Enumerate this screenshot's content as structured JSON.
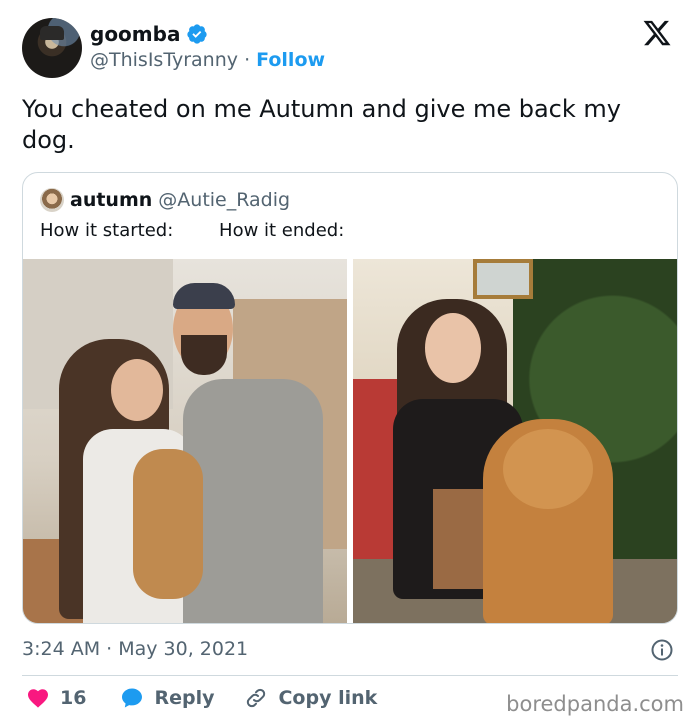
{
  "tweet": {
    "author": {
      "display_name": "goomba",
      "handle": "@ThisIsTyranny",
      "separator": "·",
      "follow_label": "Follow"
    },
    "text": "You cheated on me Autumn and give me back my dog.",
    "quoted": {
      "author_name": "autumn",
      "author_handle": "@Autie_Radig",
      "text": "How it started:        How it ended:"
    },
    "timestamp": "3:24 AM · May 30, 2021",
    "likes_count": "16",
    "reply_label": "Reply",
    "copy_link_label": "Copy link"
  },
  "watermark": "boredpanda.com",
  "colors": {
    "accent": "#1d9bf0",
    "like": "#f91880",
    "text": "#0f1419",
    "muted": "#536471",
    "border": "#cfd9de"
  },
  "icons": {
    "verified": "verified-badge-icon",
    "x": "x-logo-icon",
    "info": "info-icon",
    "like": "heart-icon",
    "reply": "speech-bubble-icon",
    "link": "link-icon"
  }
}
